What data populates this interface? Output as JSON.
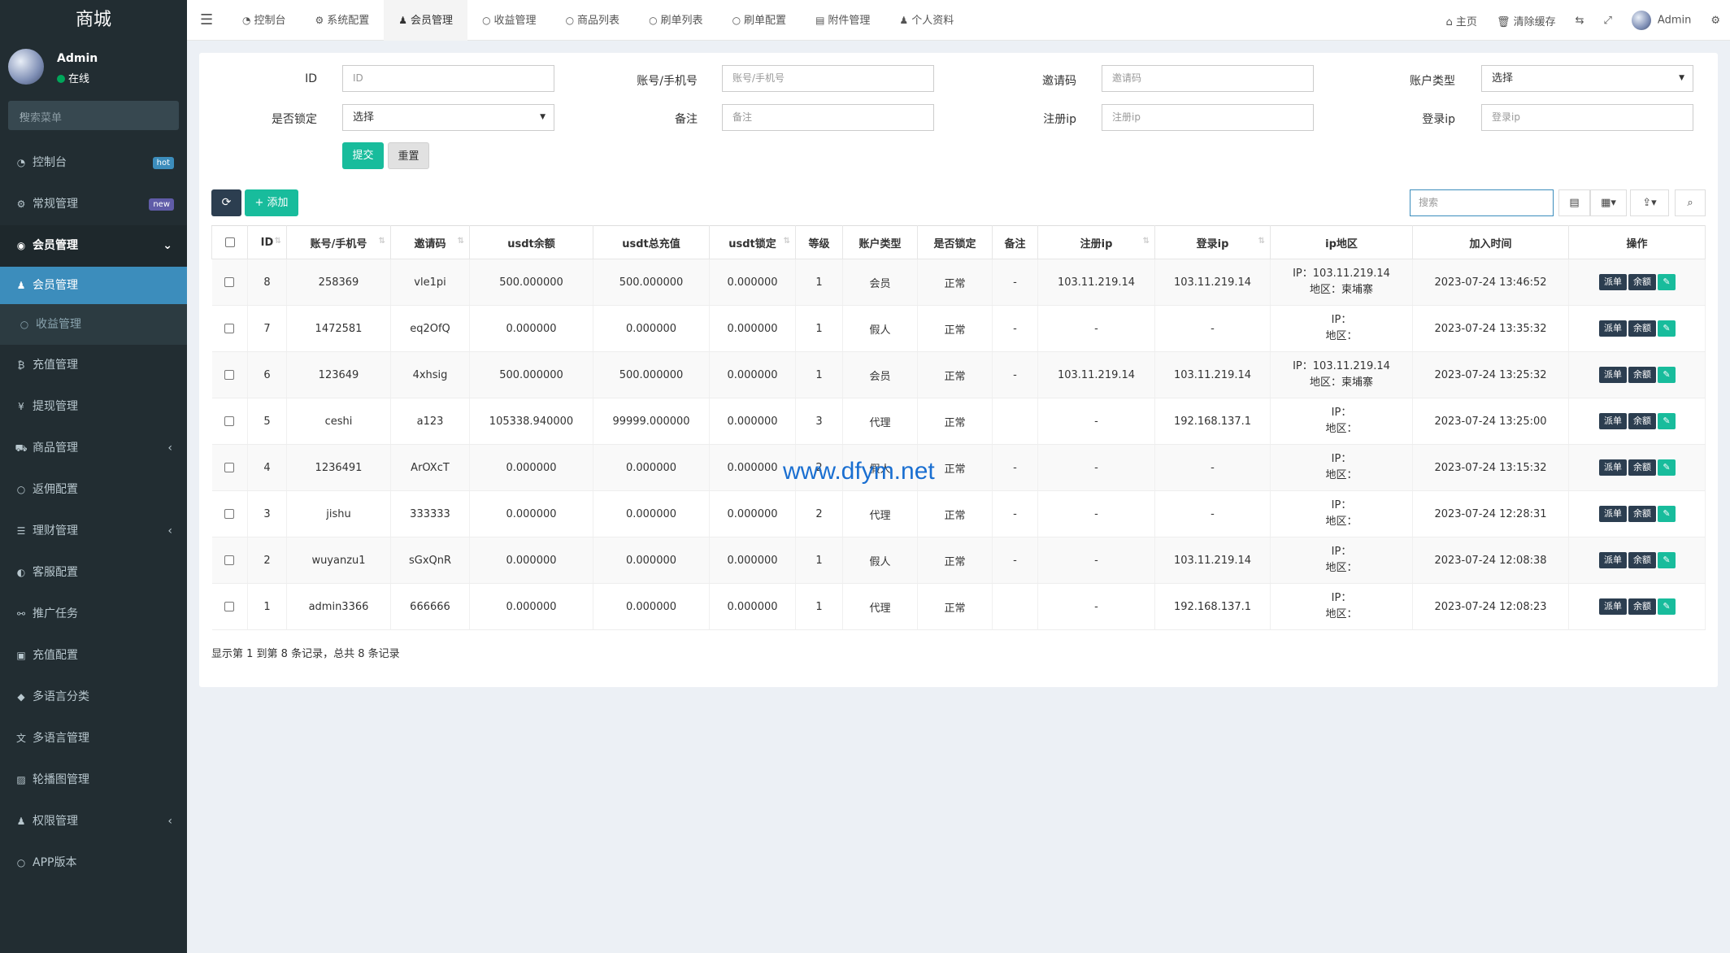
{
  "sidebar": {
    "brand": "商城",
    "user": {
      "name": "Admin",
      "status": "在线"
    },
    "search_placeholder": "搜索菜单",
    "items": [
      {
        "label": "控制台",
        "icon": "dashboard-icon",
        "badge": "hot",
        "badge_color": "#3c8dbc"
      },
      {
        "label": "常规管理",
        "icon": "cogs-icon",
        "badge": "new",
        "badge_color": "#605ca8"
      },
      {
        "label": "会员管理",
        "icon": "user-circle-icon",
        "open": true
      },
      {
        "label": "会员管理",
        "icon": "user-icon",
        "active": true,
        "sub": true
      },
      {
        "label": "收益管理",
        "icon": "circle-icon",
        "sub": true
      },
      {
        "label": "充值管理",
        "icon": "bitcoin-icon"
      },
      {
        "label": "提现管理",
        "icon": "yen-icon"
      },
      {
        "label": "商品管理",
        "icon": "cart-icon",
        "has_children": true
      },
      {
        "label": "返佣配置",
        "icon": "circle-icon"
      },
      {
        "label": "理财管理",
        "icon": "list-icon",
        "has_children": true
      },
      {
        "label": "客服配置",
        "icon": "headset-icon"
      },
      {
        "label": "推广任务",
        "icon": "link-icon"
      },
      {
        "label": "充值配置",
        "icon": "money-icon"
      },
      {
        "label": "多语言分类",
        "icon": "tag-icon"
      },
      {
        "label": "多语言管理",
        "icon": "language-icon"
      },
      {
        "label": "轮播图管理",
        "icon": "image-icon"
      },
      {
        "label": "权限管理",
        "icon": "group-icon",
        "has_children": true
      },
      {
        "label": "APP版本",
        "icon": "circle-icon"
      }
    ]
  },
  "topbar": {
    "tabs": [
      {
        "label": "控制台",
        "icon": "dashboard-icon"
      },
      {
        "label": "系统配置",
        "icon": "gear-icon"
      },
      {
        "label": "会员管理",
        "icon": "user-icon",
        "active": true
      },
      {
        "label": "收益管理",
        "icon": "circle-icon"
      },
      {
        "label": "商品列表",
        "icon": "circle-icon"
      },
      {
        "label": "刷单列表",
        "icon": "circle-icon"
      },
      {
        "label": "刷单配置",
        "icon": "circle-icon"
      },
      {
        "label": "附件管理",
        "icon": "file-image-icon"
      },
      {
        "label": "个人资料",
        "icon": "user-icon"
      }
    ],
    "home": "主页",
    "clear_cache": "清除缓存",
    "admin": "Admin"
  },
  "filters": {
    "id_label": "ID",
    "id_placeholder": "ID",
    "account_label": "账号/手机号",
    "account_placeholder": "账号/手机号",
    "invite_label": "邀请码",
    "invite_placeholder": "邀请码",
    "type_label": "账户类型",
    "type_value": "选择",
    "locked_label": "是否锁定",
    "locked_value": "选择",
    "remark_label": "备注",
    "remark_placeholder": "备注",
    "regip_label": "注册ip",
    "regip_placeholder": "注册ip",
    "loginip_label": "登录ip",
    "loginip_placeholder": "登录ip",
    "submit": "提交",
    "reset": "重置"
  },
  "toolbar": {
    "add": "添加",
    "search_placeholder": "搜索"
  },
  "table": {
    "headers": [
      "ID",
      "账号/手机号",
      "邀请码",
      "usdt余额",
      "usdt总充值",
      "usdt锁定",
      "等级",
      "账户类型",
      "是否锁定",
      "备注",
      "注册ip",
      "登录ip",
      "ip地区",
      "加入时间",
      "操作"
    ],
    "ip_prefix": "IP：",
    "region_prefix": "地区：",
    "btn_order": "派单",
    "btn_balance": "余额",
    "rows": [
      {
        "id": "8",
        "account": "258369",
        "invite": "vle1pi",
        "balance": "500.000000",
        "recharge": "500.000000",
        "locked_amt": "0.000000",
        "level": "1",
        "type": "会员",
        "locked": "正常",
        "remark": "-",
        "reg_ip": "103.11.219.14",
        "login_ip": "103.11.219.14",
        "ip": "103.11.219.14",
        "region": "柬埔寨",
        "time": "2023-07-24 13:46:52"
      },
      {
        "id": "7",
        "account": "1472581",
        "invite": "eq2OfQ",
        "balance": "0.000000",
        "recharge": "0.000000",
        "locked_amt": "0.000000",
        "level": "1",
        "type": "假人",
        "locked": "正常",
        "remark": "-",
        "reg_ip": "-",
        "login_ip": "-",
        "ip": "",
        "region": "",
        "time": "2023-07-24 13:35:32"
      },
      {
        "id": "6",
        "account": "123649",
        "invite": "4xhsig",
        "balance": "500.000000",
        "recharge": "500.000000",
        "locked_amt": "0.000000",
        "level": "1",
        "type": "会员",
        "locked": "正常",
        "remark": "-",
        "reg_ip": "103.11.219.14",
        "login_ip": "103.11.219.14",
        "ip": "103.11.219.14",
        "region": "柬埔寨",
        "time": "2023-07-24 13:25:32"
      },
      {
        "id": "5",
        "account": "ceshi",
        "invite": "a123",
        "balance": "105338.940000",
        "recharge": "99999.000000",
        "locked_amt": "0.000000",
        "level": "3",
        "type": "代理",
        "locked": "正常",
        "remark": "",
        "reg_ip": "-",
        "login_ip": "192.168.137.1",
        "ip": "",
        "region": "",
        "time": "2023-07-24 13:25:00"
      },
      {
        "id": "4",
        "account": "1236491",
        "invite": "ArOXcT",
        "balance": "0.000000",
        "recharge": "0.000000",
        "locked_amt": "0.000000",
        "level": "2",
        "type": "假人",
        "locked": "正常",
        "remark": "-",
        "reg_ip": "-",
        "login_ip": "-",
        "ip": "",
        "region": "",
        "time": "2023-07-24 13:15:32"
      },
      {
        "id": "3",
        "account": "jishu",
        "invite": "333333",
        "balance": "0.000000",
        "recharge": "0.000000",
        "locked_amt": "0.000000",
        "level": "2",
        "type": "代理",
        "locked": "正常",
        "remark": "-",
        "reg_ip": "-",
        "login_ip": "-",
        "ip": "",
        "region": "",
        "time": "2023-07-24 12:28:31"
      },
      {
        "id": "2",
        "account": "wuyanzu1",
        "invite": "sGxQnR",
        "balance": "0.000000",
        "recharge": "0.000000",
        "locked_amt": "0.000000",
        "level": "1",
        "type": "假人",
        "locked": "正常",
        "remark": "-",
        "reg_ip": "-",
        "login_ip": "103.11.219.14",
        "ip": "",
        "region": "",
        "time": "2023-07-24 12:08:38"
      },
      {
        "id": "1",
        "account": "admin3366",
        "invite": "666666",
        "balance": "0.000000",
        "recharge": "0.000000",
        "locked_amt": "0.000000",
        "level": "1",
        "type": "代理",
        "locked": "正常",
        "remark": "",
        "reg_ip": "-",
        "login_ip": "192.168.137.1",
        "ip": "",
        "region": "",
        "time": "2023-07-24 12:08:23"
      }
    ]
  },
  "pagination_info": "显示第 1 到第 8 条记录，总共 8 条记录",
  "watermark": "www.dfym.net"
}
